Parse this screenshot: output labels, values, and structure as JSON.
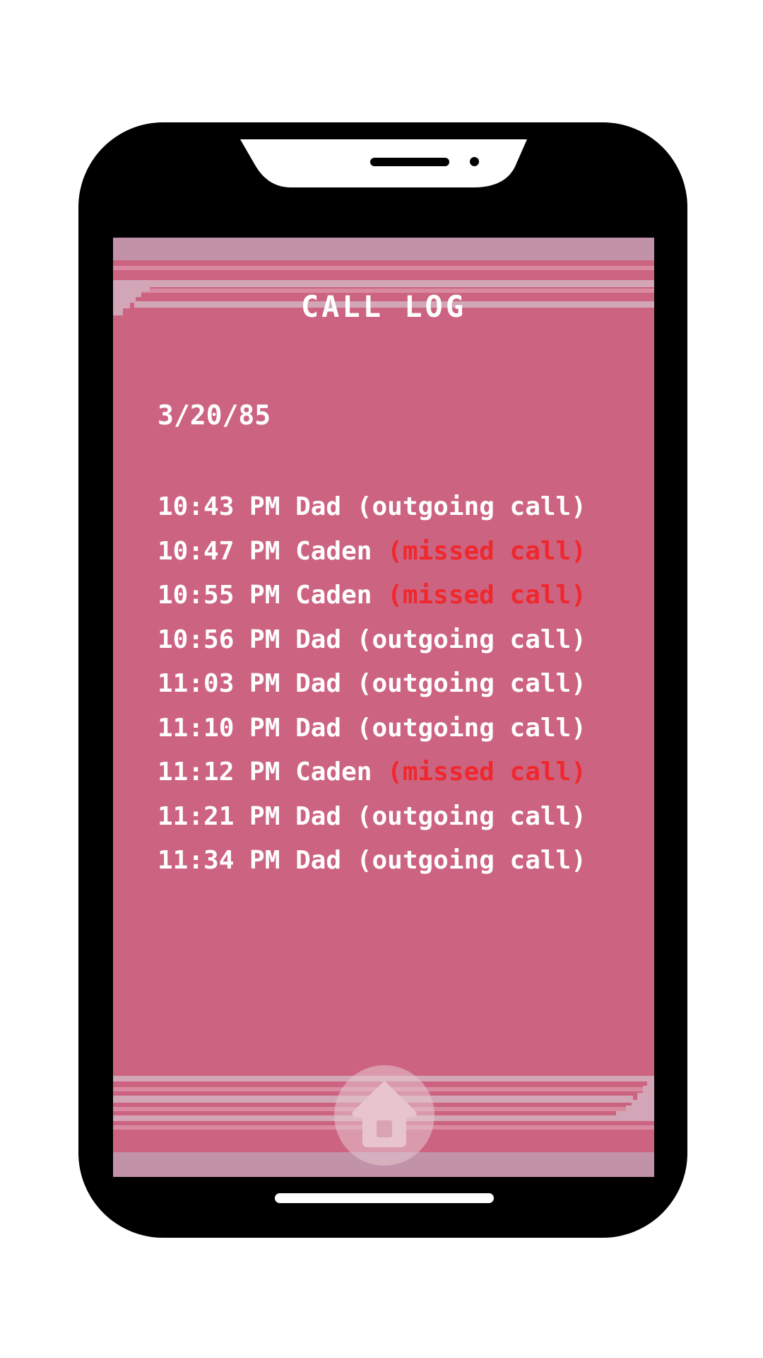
{
  "app": {
    "title": "CALL LOG"
  },
  "log": {
    "date": "3/20/85",
    "entries": [
      {
        "time": "10:43 PM",
        "contact": "Dad",
        "type": "(outgoing call)",
        "status": "outgoing"
      },
      {
        "time": "10:47 PM",
        "contact": "Caden",
        "type": "(missed call)",
        "status": "missed"
      },
      {
        "time": "10:55 PM",
        "contact": "Caden",
        "type": "(missed call)",
        "status": "missed"
      },
      {
        "time": "10:56 PM",
        "contact": "Dad",
        "type": "(outgoing call)",
        "status": "outgoing"
      },
      {
        "time": "11:03 PM",
        "contact": "Dad",
        "type": "(outgoing call)",
        "status": "outgoing"
      },
      {
        "time": "11:10 PM",
        "contact": "Dad",
        "type": "(outgoing call)",
        "status": "outgoing"
      },
      {
        "time": "11:12 PM",
        "contact": "Caden",
        "type": "(missed call)",
        "status": "missed"
      },
      {
        "time": "11:21 PM",
        "contact": "Dad",
        "type": "(outgoing call)",
        "status": "outgoing"
      },
      {
        "time": "11:34 PM",
        "contact": "Dad",
        "type": "(outgoing call)",
        "status": "outgoing"
      }
    ]
  },
  "nav": {
    "home_icon": "home-icon"
  },
  "colors": {
    "screen_bg": "#cc6380",
    "missed": "#f0282d",
    "text": "#ffffff",
    "phone_body": "#000000"
  }
}
